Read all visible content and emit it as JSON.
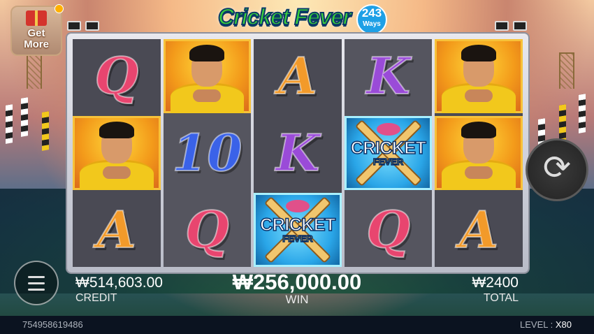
{
  "logo": {
    "title": "Cricket Fever",
    "ways_number": "243",
    "ways_label": "Ways"
  },
  "promo": {
    "label_line1": "Get",
    "label_line2": "More",
    "has_notification": true
  },
  "reels": [
    [
      "Q",
      "hero",
      "A"
    ],
    [
      "hero",
      "10",
      "Q"
    ],
    [
      "A",
      "K",
      "wild"
    ],
    [
      "K",
      "wild",
      "Q"
    ],
    [
      "hero",
      "hero",
      "A"
    ]
  ],
  "symbols": {
    "Q": {
      "text": "Q",
      "color": "#e8456f"
    },
    "A": {
      "text": "A",
      "color": "#f29a2a"
    },
    "K": {
      "text": "K",
      "color": "#9a4bd8"
    },
    "10": {
      "text": "10",
      "color": "#3a62e8"
    },
    "wild": {
      "line1": "CRICKET",
      "line2": "FEVER"
    }
  },
  "credit": {
    "value": "₩514,603.00",
    "label": "CREDIT"
  },
  "win": {
    "value": "₩256,000.00",
    "label": "WIN"
  },
  "total": {
    "value": "₩2400",
    "label": "TOTAL"
  },
  "footer": {
    "session_id": "754958619486",
    "level_label": "LEVEL :",
    "level_value": "X80"
  },
  "icons": {
    "spin": "spin-icon",
    "menu": "menu-icon"
  }
}
